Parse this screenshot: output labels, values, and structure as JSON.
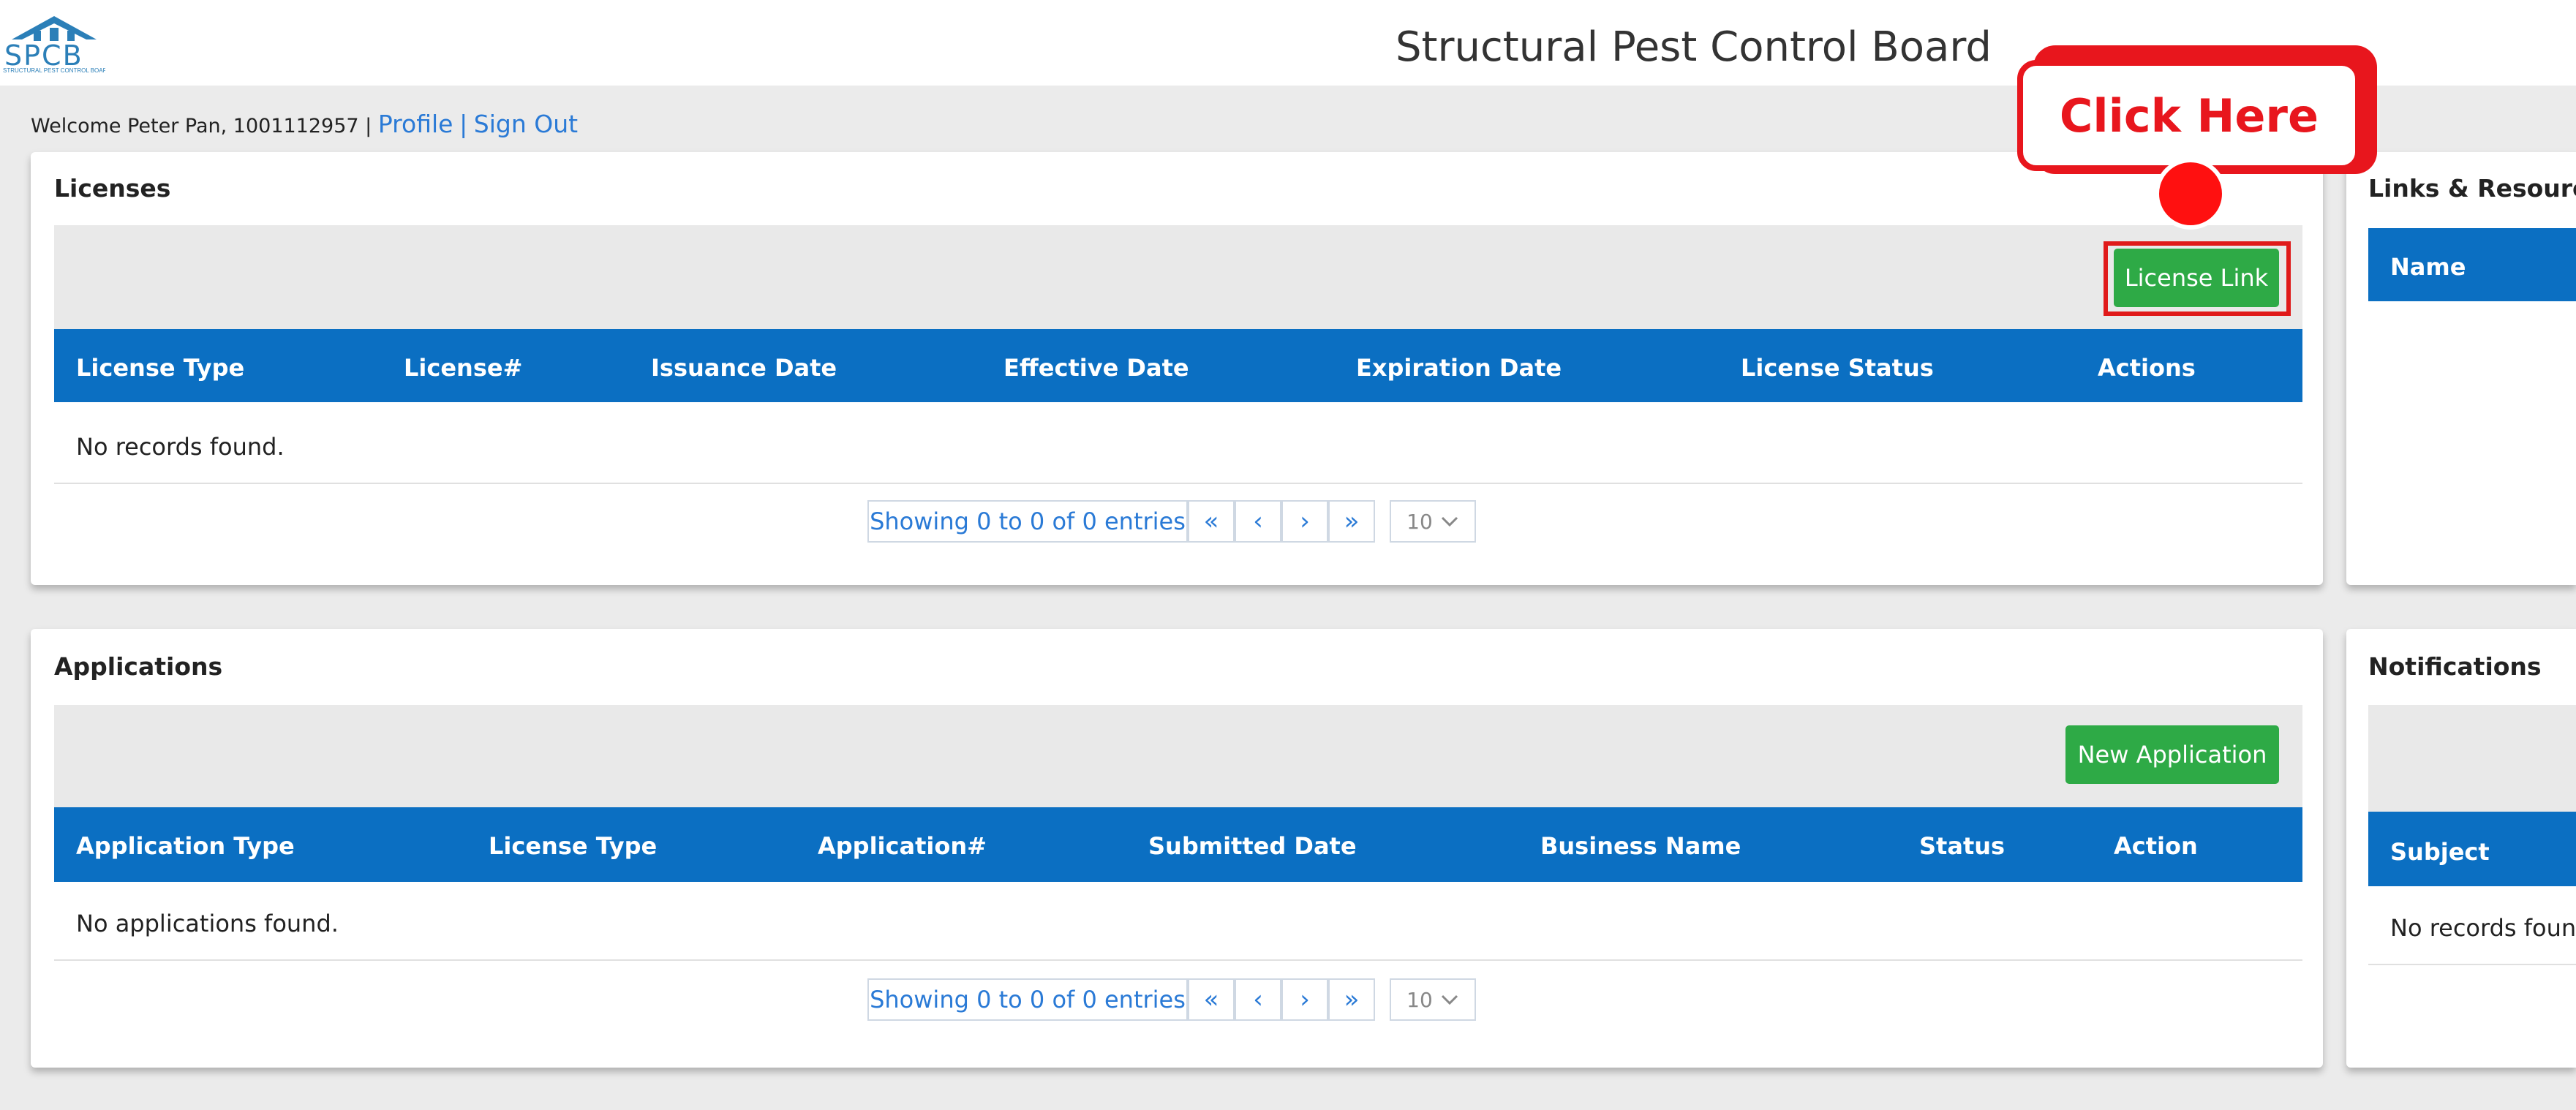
{
  "header": {
    "logo_text": "SPCB",
    "logo_subtext": "STRUCTURAL PEST CONTROL BOARD",
    "title": "Structural Pest Control Board"
  },
  "user": {
    "welcome": "Welcome Peter Pan, 1001112957 |",
    "profile_link": "Profile",
    "separator": "|",
    "signout_link": "Sign Out"
  },
  "licenses": {
    "title": "Licenses",
    "button": "License Link",
    "columns": [
      "License Type",
      "License#",
      "Issuance Date",
      "Effective Date",
      "Expiration Date",
      "License Status",
      "Actions"
    ],
    "empty": "No records found.",
    "pager": {
      "info": "Showing 0 to 0 of 0 entries",
      "first": "«",
      "prev": "‹",
      "next": "›",
      "last": "»",
      "page_size": "10"
    }
  },
  "applications": {
    "title": "Applications",
    "button": "New Application",
    "columns": [
      "Application Type",
      "License Type",
      "Application#",
      "Submitted Date",
      "Business Name",
      "Status",
      "Action"
    ],
    "empty": "No applications found.",
    "pager": {
      "info": "Showing 0 to 0 of 0 entries",
      "first": "«",
      "prev": "‹",
      "next": "›",
      "last": "»",
      "page_size": "10"
    }
  },
  "links": {
    "title": "Links & Resources",
    "column": "Name"
  },
  "notifications": {
    "title": "Notifications",
    "column": "Subject",
    "empty": "No records found"
  },
  "callout": {
    "text": "Click Here"
  },
  "colors": {
    "accent": "#0b6fc2",
    "button_green": "#2eaa46",
    "callout_red": "#e8161d",
    "link_blue": "#2a7ad6"
  }
}
